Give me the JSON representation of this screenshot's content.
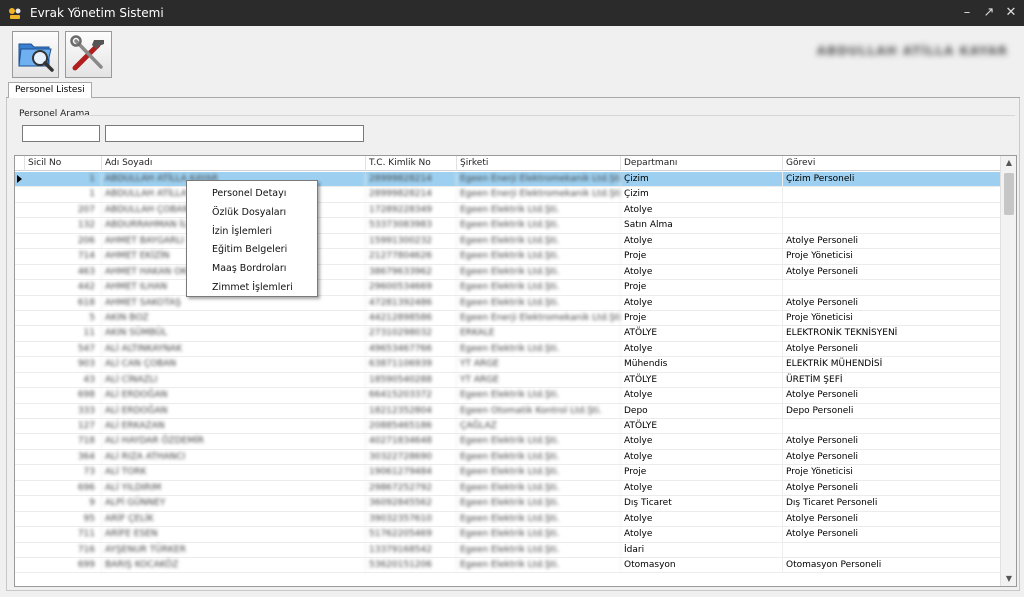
{
  "window": {
    "title": "Evrak Yönetim Sistemi",
    "user_name": "ABDULLAH ATİLLA KAYAR"
  },
  "toolbar": {
    "buttons": [
      {
        "icon": "folder-search-icon"
      },
      {
        "icon": "tools-icon"
      }
    ]
  },
  "tabs": [
    {
      "label": "Personel Listesi"
    }
  ],
  "search": {
    "group_title": "Personel Arama",
    "sicil_value": "",
    "name_value": ""
  },
  "grid": {
    "columns": [
      "Sicil No",
      "Adı Soyadı",
      "T.C. Kimlik No",
      "Şirketi",
      "Departmanı",
      "Görevi"
    ],
    "rows": [
      {
        "sicil": "1",
        "ad": "ABDULLAH ATİLLA KAYAR",
        "tc": "28999828214",
        "sirket": "Egeen Enerji Elektromekanik Ltd.Şti.",
        "dept": "Çizim",
        "gorev": "Çizim Personeli"
      },
      {
        "sicil": "1",
        "ad": "ABDULLAH ATİLLA KAYAR",
        "tc": "28999828214",
        "sirket": "Egeen Enerji Elektromekanik Ltd.Şti.",
        "dept": "Çizim",
        "gorev": ""
      },
      {
        "sicil": "207",
        "ad": "ABDULLAH ÇOBAN",
        "tc": "17289228349",
        "sirket": "Egeen Elektrik Ltd.Şti.",
        "dept": "Atolye",
        "gorev": ""
      },
      {
        "sicil": "132",
        "ad": "ABDURRAHMAN İLÇİN",
        "tc": "53373083983",
        "sirket": "Egeen Elektrik Ltd.Şti.",
        "dept": "Satın Alma",
        "gorev": ""
      },
      {
        "sicil": "206",
        "ad": "AHMET BAYGARLI",
        "tc": "15991300232",
        "sirket": "Egeen Elektrik Ltd.Şti.",
        "dept": "Atolye",
        "gorev": "Atolye Personeli"
      },
      {
        "sicil": "714",
        "ad": "AHMET EKİZİN",
        "tc": "21277804626",
        "sirket": "Egeen Elektrik Ltd.Şti.",
        "dept": "Proje",
        "gorev": "Proje Yöneticisi"
      },
      {
        "sicil": "463",
        "ad": "AHMET HAKAN OKUMUŞ",
        "tc": "38679633962",
        "sirket": "Egeen Elektrik Ltd.Şti.",
        "dept": "Atolye",
        "gorev": "Atolye Personeli"
      },
      {
        "sicil": "442",
        "ad": "AHMET ILHAN",
        "tc": "29600534669",
        "sirket": "Egeen Elektrik Ltd.Şti.",
        "dept": "Proje",
        "gorev": ""
      },
      {
        "sicil": "618",
        "ad": "AHMET SAKOTAŞ",
        "tc": "47281392486",
        "sirket": "Egeen Elektrik Ltd.Şti.",
        "dept": "Atolye",
        "gorev": "Atolye Personeli"
      },
      {
        "sicil": "5",
        "ad": "AKIN BOZ",
        "tc": "44212898586",
        "sirket": "Egeen Enerji Elektromekanik Ltd.Şti.",
        "dept": "Proje",
        "gorev": "Proje Yöneticisi"
      },
      {
        "sicil": "11",
        "ad": "AKIN SÜMBÜL",
        "tc": "27310298032",
        "sirket": "ERKALE",
        "dept": "ATÖLYE",
        "gorev": "ELEKTRONİK TEKNİSYENİ"
      },
      {
        "sicil": "547",
        "ad": "ALİ ALTINKAYNAK",
        "tc": "49653467766",
        "sirket": "Egeen Elektrik Ltd.Şti.",
        "dept": "Atolye",
        "gorev": "Atolye Personeli"
      },
      {
        "sicil": "903",
        "ad": "ALİ CAN ÇOBAN",
        "tc": "63871106939",
        "sirket": "YT ARGE",
        "dept": "Mühendis",
        "gorev": "ELEKTRİK MÜHENDİSİ"
      },
      {
        "sicil": "43",
        "ad": "ALİ CİNAZLI",
        "tc": "18590540288",
        "sirket": "YT ARGE",
        "dept": "ATÖLYE",
        "gorev": "ÜRETİM ŞEFİ"
      },
      {
        "sicil": "698",
        "ad": "ALİ ERDOĞAN",
        "tc": "66415203372",
        "sirket": "Egeen Elektrik Ltd.Şti.",
        "dept": "Atolye",
        "gorev": "Atolye Personeli"
      },
      {
        "sicil": "333",
        "ad": "ALİ ERDOĞAN",
        "tc": "18212352804",
        "sirket": "Egeen Otomatik Kontrol Ltd.Şti.",
        "dept": "Depo",
        "gorev": "Depo Personeli"
      },
      {
        "sicil": "127",
        "ad": "ALİ ERKAZAN",
        "tc": "20885465186",
        "sirket": "ÇAĞLAZ",
        "dept": "ATÖLYE",
        "gorev": ""
      },
      {
        "sicil": "718",
        "ad": "ALİ HAYDAR ÖZDEMİR",
        "tc": "40271834648",
        "sirket": "Egeen Elektrik Ltd.Şti.",
        "dept": "Atolye",
        "gorev": "Atolye Personeli"
      },
      {
        "sicil": "364",
        "ad": "ALİ RIZA ATHANCI",
        "tc": "30322728690",
        "sirket": "Egeen Elektrik Ltd.Şti.",
        "dept": "Atolye",
        "gorev": "Atolye Personeli"
      },
      {
        "sicil": "73",
        "ad": "ALİ TORK",
        "tc": "19061279484",
        "sirket": "Egeen Elektrik Ltd.Şti.",
        "dept": "Proje",
        "gorev": "Proje Yöneticisi"
      },
      {
        "sicil": "696",
        "ad": "ALİ YILDIRIM",
        "tc": "29867252792",
        "sirket": "Egeen Elektrik Ltd.Şti.",
        "dept": "Atolye",
        "gorev": "Atolye Personeli"
      },
      {
        "sicil": "9",
        "ad": "ALPİ GÜNNEY",
        "tc": "36092845562",
        "sirket": "Egeen Elektrik Ltd.Şti.",
        "dept": "Dış Ticaret",
        "gorev": "Dış Ticaret Personeli"
      },
      {
        "sicil": "95",
        "ad": "ARİF ÇELİK",
        "tc": "39032357610",
        "sirket": "Egeen Elektrik Ltd.Şti.",
        "dept": "Atolye",
        "gorev": "Atolye Personeli"
      },
      {
        "sicil": "711",
        "ad": "ARİFE ESEN",
        "tc": "51762205469",
        "sirket": "Egeen Elektrik Ltd.Şti.",
        "dept": "Atolye",
        "gorev": "Atolye Personeli"
      },
      {
        "sicil": "716",
        "ad": "AYŞENUR TÜRKER",
        "tc": "13379168542",
        "sirket": "Egeen Elektrik Ltd.Şti.",
        "dept": "İdari",
        "gorev": ""
      },
      {
        "sicil": "699",
        "ad": "BARIŞ KOCAKÖZ",
        "tc": "53620151206",
        "sirket": "Egeen Elektrik Ltd.Şti.",
        "dept": "Otomasyon",
        "gorev": "Otomasyon Personeli"
      }
    ]
  },
  "context_menu": {
    "items": [
      "Personel Detayı",
      "Özlük Dosyaları",
      "İzin İşlemleri",
      "Eğitim Belgeleri",
      "Maaş Bordroları",
      "Zimmet İşlemleri"
    ]
  },
  "colors": {
    "titlebar": "#2b2b2b",
    "selected_row": "#9dd0f0"
  }
}
